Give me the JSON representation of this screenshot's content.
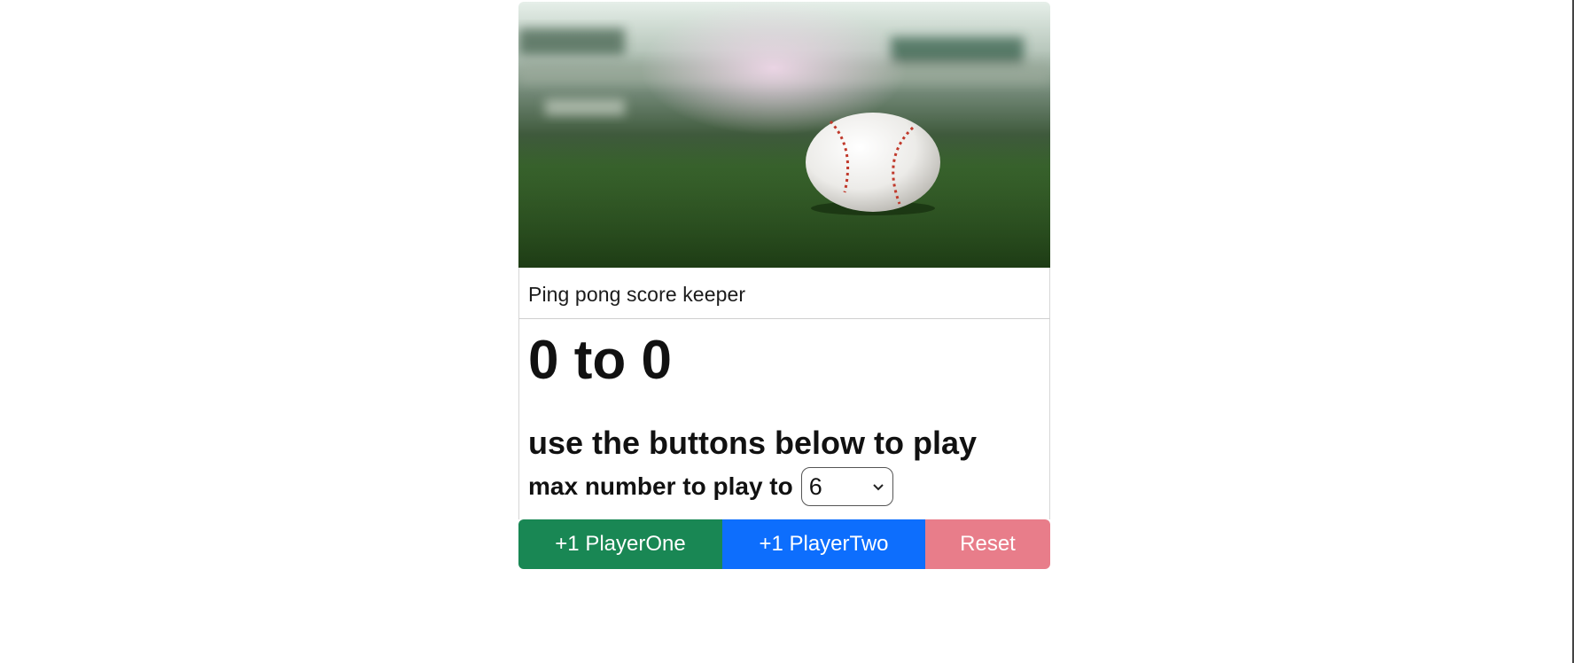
{
  "card": {
    "image_alt": "baseball on grass field",
    "caption": "Ping pong score keeper"
  },
  "score": {
    "display": "0 to 0"
  },
  "instructions": "use the buttons below to play",
  "max": {
    "label": "max number to play to",
    "selected": "6"
  },
  "buttons": {
    "player_one": "+1 PlayerOne",
    "player_two": "+1 PlayerTwo",
    "reset": "Reset"
  },
  "colors": {
    "player_one": "#198754",
    "player_two": "#0d6efd",
    "reset": "#e87d8a"
  }
}
